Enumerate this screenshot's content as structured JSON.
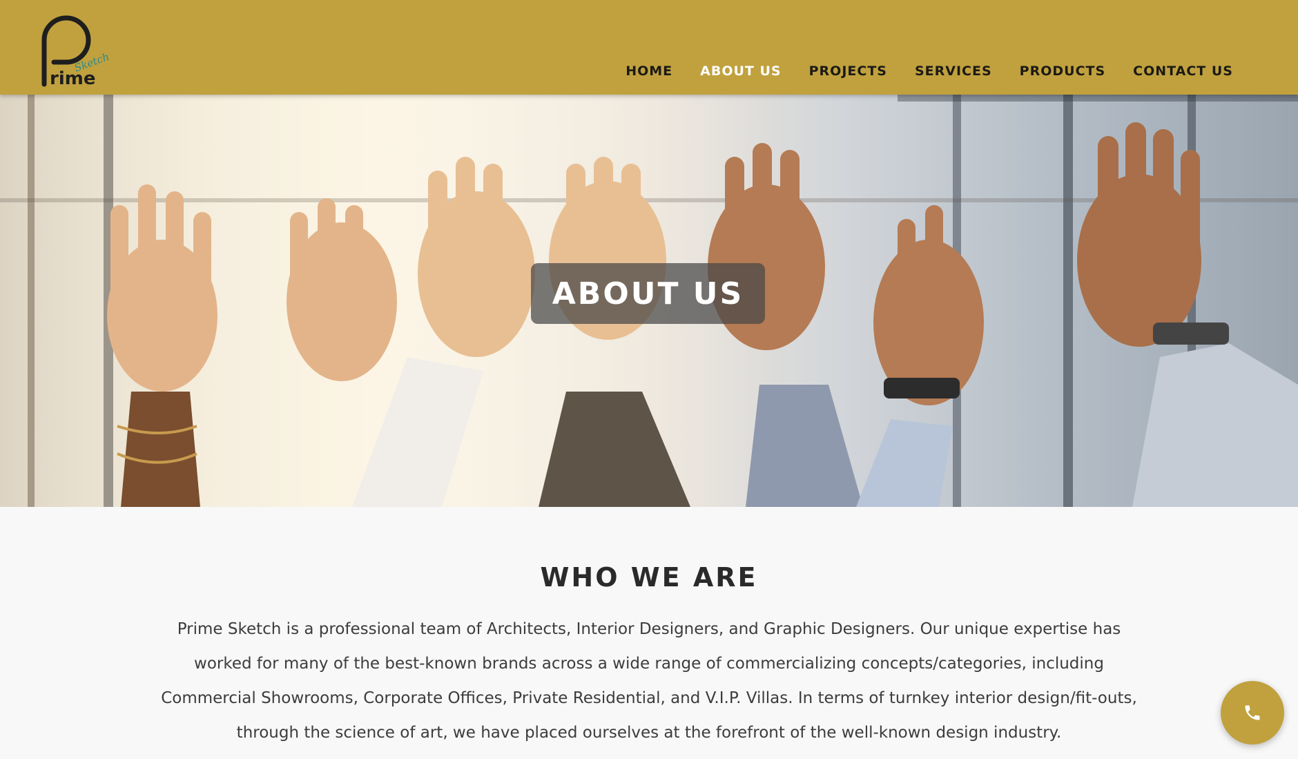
{
  "brand": {
    "logo_main": "Prime",
    "logo_script": "Sketch"
  },
  "colors": {
    "header_bg": "#c0a13e",
    "nav_text": "#1c1a14",
    "nav_active": "#ffffff",
    "page_bg": "#f8f8f8",
    "accent_teal": "#2e8a8a"
  },
  "nav": {
    "items": [
      {
        "label": "HOME",
        "active": false
      },
      {
        "label": "ABOUT US",
        "active": true
      },
      {
        "label": "PROJECTS",
        "active": false
      },
      {
        "label": "SERVICES",
        "active": false
      },
      {
        "label": "PRODUCTS",
        "active": false
      },
      {
        "label": "CONTACT US",
        "active": false
      }
    ]
  },
  "hero": {
    "title": "ABOUT US",
    "image_icon": "raised-hands-photo"
  },
  "about": {
    "heading": "WHO WE ARE",
    "lines": [
      "Prime Sketch is a professional team of Architects, Interior Designers, and Graphic Designers. Our unique expertise has",
      "worked for many of the best-known brands across a wide range of commercializing concepts/categories, including",
      "Commercial Showrooms, Corporate Offices, Private Residential, and V.I.P. Villas. In terms of turnkey interior design/fit-outs,",
      "through the science of art, we have placed ourselves at the forefront of the well-known design industry."
    ]
  },
  "call_button": {
    "icon": "phone-icon"
  }
}
